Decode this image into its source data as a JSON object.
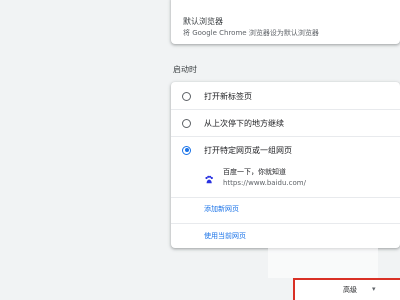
{
  "default_browser": {
    "title": "默认浏览器",
    "subtitle": "将 Google Chrome 浏览器设为默认浏览器"
  },
  "on_startup": {
    "section_title": "启动时",
    "options": [
      {
        "label": "打开新标签页",
        "checked": false
      },
      {
        "label": "从上次停下的地方继续",
        "checked": false
      },
      {
        "label": "打开特定网页或一组网页",
        "checked": true
      }
    ],
    "page": {
      "name": "百度一下，你就知道",
      "url": "https://www.baidu.com/"
    },
    "add_page_link": "添加新网页",
    "use_current_link": "使用当前网页"
  },
  "advanced": {
    "label": "高级",
    "arrow": "▾"
  },
  "colors": {
    "accent": "#1a73e8",
    "highlight_border": "#d93025"
  },
  "icons": {
    "page_favicon": "baidu-paw-icon"
  }
}
